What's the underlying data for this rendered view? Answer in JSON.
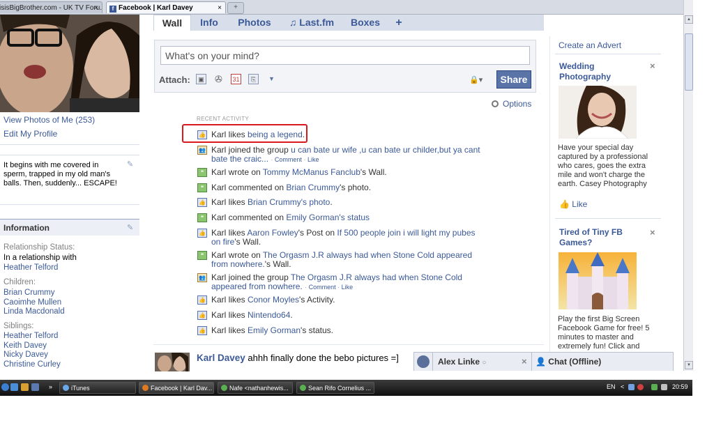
{
  "browser": {
    "tabs": [
      {
        "label": "isisBigBrother.com - UK TV Foru...",
        "active": false
      },
      {
        "label": "Facebook | Karl Davey",
        "active": true
      }
    ],
    "close_glyph": "×",
    "newtab_glyph": "+"
  },
  "fb_tabs": [
    {
      "label": "Wall",
      "active": true
    },
    {
      "label": "Info",
      "active": false
    },
    {
      "label": "Photos",
      "active": false
    },
    {
      "label": "♫ Last.fm",
      "active": false
    },
    {
      "label": "Boxes",
      "active": false
    },
    {
      "label": "+",
      "active": false
    }
  ],
  "left": {
    "view_photos": "View Photos of Me (253)",
    "edit_profile": "Edit My Profile",
    "bio": "It begins with me covered in sperm, trapped in my old man's balls. Then, suddenly... ESCAPE!",
    "info_title": "Information",
    "relationship_label": "Relationship Status:",
    "relationship_value": "In a relationship with",
    "relationship_with": "Heather Telford",
    "children_label": "Children:",
    "children": [
      "Brian Crummy",
      "Caoimhe Mullen",
      "Linda Macdonald"
    ],
    "siblings_label": "Siblings:",
    "siblings": [
      "Heather Telford",
      "Keith Davey",
      "Nicky Davey",
      "Christine Curley"
    ]
  },
  "publisher": {
    "placeholder": "What's on your mind?",
    "attach_label": "Attach:",
    "share_label": "Share"
  },
  "feed": {
    "options_label": "Options",
    "recent_label": "RECENT ACTIVITY",
    "comment_label": "Comment",
    "like_label": "Like",
    "dot_separator": "·",
    "items": [
      {
        "type": "like",
        "text": "Karl likes ",
        "link": "being a legend",
        "rest": "."
      },
      {
        "type": "group",
        "text": "Karl joined the group ",
        "link": "u can bate ur wife ,u can bate ur childer,but ya cant bate the craic...",
        "rest": ""
      },
      {
        "type": "wall",
        "text": "Karl wrote on ",
        "link": "Tommy McManus Fanclub",
        "rest": "'s Wall."
      },
      {
        "type": "wall",
        "text": "Karl commented on ",
        "link": "Brian Crummy",
        "rest": "'s photo."
      },
      {
        "type": "like",
        "text": "Karl likes ",
        "link": "Brian Crummy's photo",
        "rest": "."
      },
      {
        "type": "wall",
        "text": "Karl commented on ",
        "link": "Emily Gorman's status",
        "rest": ""
      },
      {
        "type": "like",
        "text": "Karl likes ",
        "link": "Aaron Fowley",
        "rest": "'s Post on ",
        "link2": "If 500 people join i will light my pubes on fire",
        "rest2": "'s Wall."
      },
      {
        "type": "wall",
        "text": "Karl wrote on ",
        "link": "The Orgasm J.R always had when Stone Cold appeared from nowhere.",
        "rest": "'s Wall."
      },
      {
        "type": "group",
        "text": "Karl joined the group ",
        "link": "The Orgasm J.R always had when Stone Cold appeared from nowhere.",
        "rest": ""
      },
      {
        "type": "like",
        "text": "Karl likes ",
        "link": "Conor Moyles",
        "rest": "'s Activity."
      },
      {
        "type": "like",
        "text": "Karl likes ",
        "link": "Nintendo64",
        "rest": "."
      },
      {
        "type": "like",
        "text": "Karl likes ",
        "link": "Emily Gorman",
        "rest": "'s status."
      }
    ],
    "story_author": "Karl Davey",
    "story_text": " ahhh finally done the bebo pictures =]"
  },
  "ads": {
    "create": "Create an Advert",
    "ad1_title": "Wedding Photography",
    "ad1_text": "Have your special day captured by a professional who cares, goes the extra mile and won't charge the earth. Casey Photography",
    "like_label": "Like",
    "ad2_title": "Tired of Tiny FB Games?",
    "ad2_text": "Play the first Big Screen Facebook Game for free! 5 minutes to master and extremely fun! Click and",
    "close_glyph": "×"
  },
  "chat": {
    "friend": "Alex Linke",
    "status": "Chat (Offline)",
    "close_glyph": "×"
  },
  "taskbar": {
    "chevron": "»",
    "items": [
      "iTunes",
      "Facebook | Karl Dav...",
      "Nafe <nathanhewis...",
      "Sean Rifo Cornelius ..."
    ],
    "lang": "EN",
    "tray_chevron": "<",
    "clock": "20:59"
  },
  "colors": {
    "fb_blue": "#3b5998",
    "highlight": "#d8181f"
  }
}
